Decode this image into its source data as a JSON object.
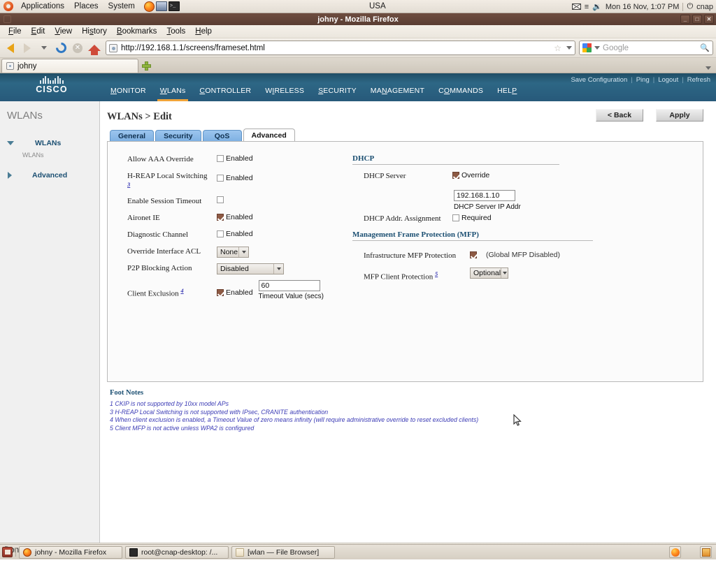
{
  "desktop": {
    "menus": [
      "Applications",
      "Places",
      "System"
    ],
    "launchers": [
      "firefox-icon",
      "network-icon",
      "terminal-icon"
    ],
    "locale_label": "USA",
    "clock": "Mon 16 Nov,  1:07 PM",
    "user": "cnap",
    "tray_icons": [
      "mail-icon",
      "list-icon",
      "volume-icon"
    ]
  },
  "window": {
    "title": "johny - Mozilla Firefox",
    "buttons": {
      "minimize": "_",
      "maximize": "□",
      "close": "✕"
    }
  },
  "browser": {
    "menubar": [
      "File",
      "Edit",
      "View",
      "History",
      "Bookmarks",
      "Tools",
      "Help"
    ],
    "url": "http://192.168.1.1/screens/frameset.html",
    "search_placeholder": "Google",
    "tabs": [
      {
        "label": "johny"
      }
    ],
    "status": "Done"
  },
  "cisco": {
    "logo_text": "CISCO",
    "nav": [
      "MONITOR",
      "WLANs",
      "CONTROLLER",
      "WIRELESS",
      "SECURITY",
      "MANAGEMENT",
      "COMMANDS",
      "HELP"
    ],
    "active_nav": "WLANs",
    "top_links": [
      "Save Configuration",
      "Ping",
      "Logout",
      "Refresh"
    ],
    "accent_color": "#f0a43a",
    "header_color": "#2d6785"
  },
  "sidebar": {
    "title": "WLANs",
    "items": [
      {
        "label": "WLANs",
        "sub": "WLANs",
        "expanded": true
      },
      {
        "label": "Advanced",
        "sub": "",
        "expanded": false
      }
    ]
  },
  "main": {
    "page_title_prefix": "WLANs > ",
    "page_title": "WLANs > Edit",
    "buttons": {
      "back": "< Back",
      "apply": "Apply"
    },
    "tabs": [
      {
        "label": "General",
        "active": false
      },
      {
        "label": "Security",
        "active": false
      },
      {
        "label": "QoS",
        "active": false
      },
      {
        "label": "Advanced",
        "active": true
      }
    ],
    "left_fields": [
      {
        "label": "Allow AAA Override",
        "note": "",
        "control": "checkbox",
        "checked": false,
        "control_label": "Enabled"
      },
      {
        "label": "H-REAP Local Switching",
        "note": "3",
        "control": "checkbox",
        "checked": false,
        "control_label": "Enabled"
      },
      {
        "label": "Enable Session Timeout",
        "note": "",
        "control": "checkbox",
        "checked": false,
        "control_label": ""
      },
      {
        "label": "Aironet IE",
        "note": "",
        "control": "checkbox",
        "checked": true,
        "control_label": "Enabled"
      },
      {
        "label": "Diagnostic Channel",
        "note": "",
        "control": "checkbox",
        "checked": false,
        "control_label": "Enabled"
      },
      {
        "label": "Override Interface ACL",
        "note": "",
        "control": "select",
        "value": "None"
      },
      {
        "label": "P2P Blocking Action",
        "note": "",
        "control": "select",
        "value": "Disabled"
      },
      {
        "label": "Client Exclusion",
        "note": "4",
        "control": "checkbox-text",
        "checked": true,
        "control_label": "Enabled",
        "text_value": "60",
        "text_caption": "Timeout Value (secs)"
      }
    ],
    "dhcp": {
      "section_title": "DHCP",
      "server_label": "DHCP Server",
      "server_checkbox_label": "Override",
      "server_checked": true,
      "ip_value": "192.168.1.10",
      "ip_caption": "DHCP Server IP Addr",
      "assignment_label": "DHCP Addr. Assignment",
      "assignment_checkbox_label": "Required",
      "assignment_checked": false
    },
    "mfp": {
      "section_title": "Management Frame Protection (MFP)",
      "infra_label": "Infrastructure MFP Protection",
      "infra_checked": true,
      "infra_note": "(Global MFP Disabled)",
      "client_label": "MFP Client Protection",
      "client_note": "5",
      "client_value": "Optional"
    },
    "footnotes": {
      "title": "Foot Notes",
      "lines": [
        "1 CKIP is not supported by 10xx model APs",
        "3 H-REAP Local Switching is not supported with IPsec, CRANITE authentication",
        "4 When client exclusion is enabled, a Timeout Value of zero means infinity (will require administrative override to reset excluded clients)",
        "5 Client MFP is not active unless WPA2 is configured"
      ]
    }
  },
  "taskbar": {
    "tasks": [
      {
        "label": "johny - Mozilla Firefox",
        "icon": "firefox-icon"
      },
      {
        "label": "root@cnap-desktop: /...",
        "icon": "terminal-icon"
      },
      {
        "label": "[wlan — File Browser]",
        "icon": "folder-icon"
      }
    ]
  }
}
